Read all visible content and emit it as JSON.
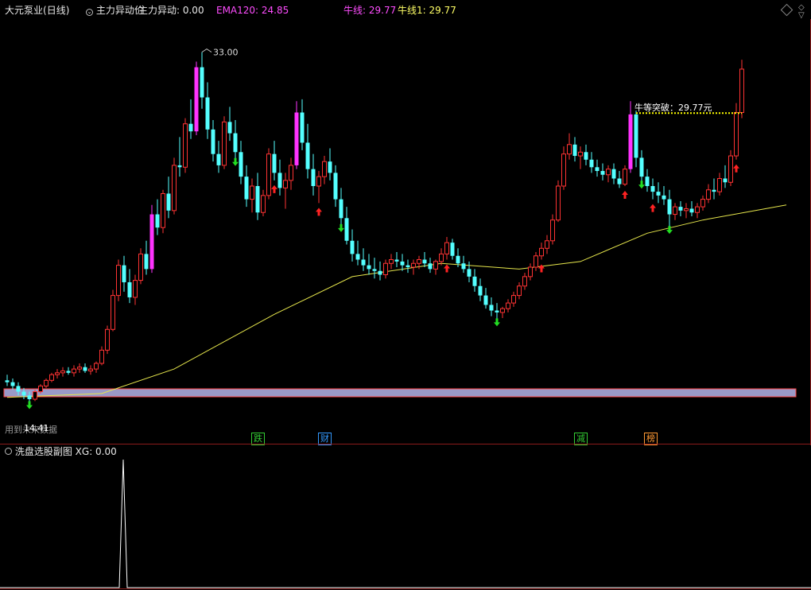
{
  "header": {
    "stock": "大元泵业",
    "period": "(日线)",
    "indicator_label": "主力异动价",
    "zlyd_label": "主力异动: 0.00",
    "ema_label": "EMA120: 24.85",
    "niuxian_label": "牛线: 29.77",
    "niuxian1_label": "牛线1: 29.77"
  },
  "annotations": {
    "high_label": "33.00",
    "breakout_label": "牛等突破：29.77元",
    "low_label": "14.41",
    "footnote": "用到未来数据"
  },
  "events": [
    {
      "label": "跌",
      "color": "#33cc33"
    },
    {
      "label": "财",
      "color": "#3399ff"
    },
    {
      "label": "减",
      "color": "#33cc33"
    },
    {
      "label": "榜",
      "color": "#ff9933"
    }
  ],
  "sub_chart": {
    "title": "洗盘选股副图",
    "value_label": "XG: 0.00"
  },
  "colors": {
    "up": "#ff3333",
    "down": "#54ffff",
    "strong_up": "#ff33ff",
    "strong_down": "#33ff33",
    "ema": "#e6e64c",
    "breakout": "#ffff00",
    "band": "#9a9ac8"
  },
  "chart_data": {
    "type": "candlestick",
    "ylim": [
      13.0,
      34.5
    ],
    "candles": [
      [
        15.6,
        15.9,
        15.3,
        15.5
      ],
      [
        15.5,
        15.7,
        15.1,
        15.3
      ],
      [
        15.3,
        15.5,
        14.8,
        15.0
      ],
      [
        15.0,
        15.2,
        14.6,
        14.8
      ],
      [
        14.8,
        15.0,
        14.41,
        14.6
      ],
      [
        14.6,
        15.1,
        14.5,
        15.0
      ],
      [
        15.0,
        15.4,
        14.9,
        15.3
      ],
      [
        15.3,
        15.7,
        15.2,
        15.6
      ],
      [
        15.6,
        16.0,
        15.5,
        15.9
      ],
      [
        15.9,
        16.2,
        15.7,
        16.0
      ],
      [
        16.0,
        16.3,
        15.8,
        16.1
      ],
      [
        16.1,
        16.3,
        15.9,
        16.0
      ],
      [
        16.0,
        16.4,
        15.8,
        16.2
      ],
      [
        16.2,
        16.5,
        16.0,
        16.3
      ],
      [
        16.3,
        16.5,
        16.0,
        16.1
      ],
      [
        16.1,
        16.4,
        15.9,
        16.2
      ],
      [
        16.2,
        16.6,
        16.0,
        16.5
      ],
      [
        16.5,
        17.4,
        16.4,
        17.2
      ],
      [
        17.2,
        18.5,
        17.0,
        18.3
      ],
      [
        18.3,
        20.4,
        18.2,
        20.1
      ],
      [
        20.1,
        22.0,
        19.8,
        21.7
      ],
      [
        21.7,
        22.2,
        20.3,
        20.8
      ],
      [
        20.8,
        21.5,
        19.7,
        20.0
      ],
      [
        20.0,
        21.2,
        19.6,
        20.9
      ],
      [
        20.9,
        22.6,
        20.7,
        22.3
      ],
      [
        22.3,
        23.0,
        21.2,
        21.5
      ],
      [
        21.5,
        24.9,
        21.3,
        24.4
      ],
      [
        24.4,
        25.2,
        23.3,
        23.7
      ],
      [
        23.7,
        25.7,
        23.4,
        25.5
      ],
      [
        25.5,
        26.4,
        24.2,
        24.6
      ],
      [
        24.6,
        27.4,
        24.4,
        27.0
      ],
      [
        27.0,
        28.5,
        26.4,
        26.9
      ],
      [
        26.9,
        29.5,
        26.6,
        29.2
      ],
      [
        29.2,
        30.5,
        28.4,
        28.8
      ],
      [
        28.8,
        32.5,
        28.6,
        32.2
      ],
      [
        32.2,
        33.0,
        30.0,
        30.6
      ],
      [
        30.6,
        31.4,
        28.4,
        28.9
      ],
      [
        28.9,
        29.4,
        27.2,
        27.6
      ],
      [
        27.6,
        28.3,
        26.6,
        27.0
      ],
      [
        27.0,
        29.6,
        26.8,
        29.3
      ],
      [
        29.3,
        30.1,
        28.3,
        28.7
      ],
      [
        28.7,
        29.4,
        27.3,
        27.7
      ],
      [
        27.7,
        28.3,
        26.0,
        26.4
      ],
      [
        26.4,
        27.0,
        24.8,
        25.2
      ],
      [
        25.2,
        26.3,
        24.5,
        25.9
      ],
      [
        25.9,
        26.6,
        24.1,
        24.5
      ],
      [
        24.5,
        25.7,
        24.3,
        25.4
      ],
      [
        25.4,
        27.9,
        25.2,
        27.6
      ],
      [
        27.6,
        28.3,
        26.2,
        26.6
      ],
      [
        26.6,
        27.3,
        25.4,
        25.8
      ],
      [
        25.8,
        26.6,
        24.7,
        26.2
      ],
      [
        26.2,
        27.4,
        25.7,
        27.0
      ],
      [
        27.0,
        30.4,
        26.8,
        29.8
      ],
      [
        29.8,
        30.5,
        27.8,
        28.2
      ],
      [
        28.2,
        29.2,
        26.3,
        26.8
      ],
      [
        26.8,
        27.6,
        25.4,
        25.9
      ],
      [
        25.9,
        26.7,
        25.0,
        26.4
      ],
      [
        26.4,
        27.5,
        26.0,
        27.2
      ],
      [
        27.2,
        27.9,
        26.2,
        26.6
      ],
      [
        26.6,
        27.0,
        24.8,
        25.2
      ],
      [
        25.2,
        25.8,
        23.8,
        24.2
      ],
      [
        24.2,
        24.8,
        22.8,
        23.0
      ],
      [
        23.0,
        23.6,
        21.9,
        22.3
      ],
      [
        22.3,
        23.0,
        21.7,
        22.0
      ],
      [
        22.0,
        22.6,
        21.4,
        21.7
      ],
      [
        21.7,
        22.3,
        21.2,
        21.5
      ],
      [
        21.5,
        22.1,
        21.0,
        21.4
      ],
      [
        21.4,
        21.9,
        20.9,
        21.2
      ],
      [
        21.2,
        22.0,
        21.0,
        21.8
      ],
      [
        21.8,
        22.3,
        21.5,
        22.0
      ],
      [
        22.0,
        22.4,
        21.6,
        21.9
      ],
      [
        21.9,
        22.3,
        21.4,
        21.7
      ],
      [
        21.7,
        22.0,
        21.3,
        21.6
      ],
      [
        21.6,
        22.0,
        21.2,
        21.8
      ],
      [
        21.8,
        22.2,
        21.5,
        22.0
      ],
      [
        22.0,
        22.4,
        21.6,
        21.8
      ],
      [
        21.8,
        22.1,
        21.3,
        21.5
      ],
      [
        21.5,
        22.0,
        21.2,
        21.9
      ],
      [
        21.9,
        22.6,
        21.7,
        22.3
      ],
      [
        22.3,
        23.2,
        22.0,
        22.9
      ],
      [
        22.9,
        23.1,
        22.0,
        22.2
      ],
      [
        22.2,
        22.6,
        21.6,
        21.8
      ],
      [
        21.8,
        22.2,
        21.3,
        21.5
      ],
      [
        21.5,
        21.9,
        20.8,
        21.1
      ],
      [
        21.1,
        21.5,
        20.3,
        20.6
      ],
      [
        20.6,
        21.0,
        19.8,
        20.1
      ],
      [
        20.1,
        20.5,
        19.4,
        19.6
      ],
      [
        19.6,
        20.0,
        19.0,
        19.3
      ],
      [
        19.3,
        19.7,
        18.8,
        19.2
      ],
      [
        19.2,
        19.5,
        18.9,
        19.4
      ],
      [
        19.4,
        19.9,
        19.2,
        19.7
      ],
      [
        19.7,
        20.3,
        19.5,
        20.1
      ],
      [
        20.1,
        20.8,
        19.9,
        20.6
      ],
      [
        20.6,
        21.3,
        20.4,
        21.1
      ],
      [
        21.1,
        21.8,
        20.9,
        21.6
      ],
      [
        21.6,
        22.4,
        21.4,
        22.2
      ],
      [
        22.2,
        22.9,
        22.0,
        22.6
      ],
      [
        22.6,
        23.3,
        22.3,
        23.0
      ],
      [
        23.0,
        24.4,
        22.8,
        24.1
      ],
      [
        24.1,
        26.2,
        24.0,
        25.9
      ],
      [
        25.9,
        28.0,
        25.7,
        27.6
      ],
      [
        27.6,
        28.7,
        27.3,
        28.1
      ],
      [
        28.1,
        28.5,
        27.2,
        27.5
      ],
      [
        27.5,
        28.0,
        26.8,
        27.7
      ],
      [
        27.7,
        28.1,
        27.0,
        27.3
      ],
      [
        27.3,
        27.7,
        26.6,
        26.9
      ],
      [
        26.9,
        27.3,
        26.4,
        26.7
      ],
      [
        26.7,
        27.1,
        26.2,
        26.5
      ],
      [
        26.5,
        27.0,
        26.1,
        26.8
      ],
      [
        26.8,
        27.1,
        26.0,
        26.3
      ],
      [
        26.3,
        26.7,
        25.8,
        26.0
      ],
      [
        26.0,
        27.0,
        25.9,
        26.8
      ],
      [
        26.8,
        30.4,
        26.6,
        29.7
      ],
      [
        29.7,
        29.9,
        26.9,
        27.4
      ],
      [
        27.4,
        27.8,
        26.1,
        26.4
      ],
      [
        26.4,
        26.8,
        25.6,
        25.9
      ],
      [
        25.9,
        26.3,
        25.2,
        25.6
      ],
      [
        25.6,
        26.1,
        25.0,
        25.4
      ],
      [
        25.4,
        25.9,
        24.9,
        25.2
      ],
      [
        25.2,
        25.7,
        23.7,
        24.4
      ],
      [
        24.4,
        25.0,
        24.1,
        24.8
      ],
      [
        24.8,
        25.1,
        24.3,
        24.6
      ],
      [
        24.6,
        25.0,
        24.2,
        24.7
      ],
      [
        24.7,
        25.1,
        24.3,
        24.5
      ],
      [
        24.5,
        25.0,
        24.2,
        24.8
      ],
      [
        24.8,
        25.4,
        24.6,
        25.2
      ],
      [
        25.2,
        26.0,
        25.0,
        25.7
      ],
      [
        25.7,
        26.3,
        25.2,
        25.6
      ],
      [
        25.6,
        26.6,
        25.4,
        26.3
      ],
      [
        26.3,
        27.0,
        25.8,
        26.1
      ],
      [
        26.1,
        27.8,
        25.9,
        27.5
      ],
      [
        27.5,
        30.3,
        27.3,
        29.8
      ],
      [
        29.8,
        32.6,
        29.5,
        32.1
      ]
    ],
    "ema120": {
      "name": "EMA120",
      "points": [
        [
          0,
          14.7
        ],
        [
          17,
          14.9
        ],
        [
          30,
          16.2
        ],
        [
          48,
          19.1
        ],
        [
          62,
          21.1
        ],
        [
          78,
          21.8
        ],
        [
          92,
          21.5
        ],
        [
          103,
          21.9
        ],
        [
          115,
          23.4
        ],
        [
          125,
          24.1
        ],
        [
          140,
          24.9
        ]
      ]
    },
    "breakout_level": 29.77,
    "high": 33.0,
    "low": 14.41,
    "sub_xg": {
      "spike_index": 20,
      "peak": 1.0,
      "value": 0.0
    }
  }
}
